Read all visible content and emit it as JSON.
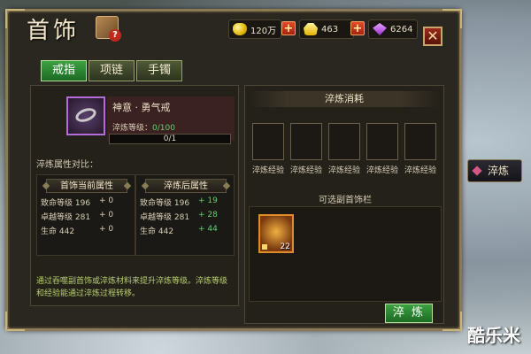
{
  "header": {
    "title": "首饰"
  },
  "currency": {
    "gold": "120万",
    "ingot": "463",
    "gem": "6264"
  },
  "tabs": [
    {
      "label": "戒指",
      "active": true
    },
    {
      "label": "项链",
      "active": false
    },
    {
      "label": "手镯",
      "active": false
    }
  ],
  "item": {
    "name": "神意 · 勇气戒",
    "refine_label": "淬炼等级：",
    "refine_value": "0/100",
    "progress_text": "0/1"
  },
  "compare": {
    "title": "淬炼属性对比：",
    "current": {
      "head": "首饰当前属性",
      "rows": [
        {
          "name": "致命等级 196",
          "inc": "+ 0"
        },
        {
          "name": "卓越等级 281",
          "inc": "+ 0"
        },
        {
          "name": "生命 442",
          "inc": "+ 0"
        }
      ]
    },
    "after": {
      "head": "淬炼后属性",
      "rows": [
        {
          "name": "致命等级 196",
          "inc": "+ 19"
        },
        {
          "name": "卓越等级 281",
          "inc": "+ 28"
        },
        {
          "name": "生命 442",
          "inc": "+ 44"
        }
      ]
    }
  },
  "hint": "通过吞噬副首饰或淬炼材料来提升淬炼等级。淬炼等级和经验能通过淬炼过程转移。",
  "consume": {
    "head": "淬炼消耗",
    "slots": [
      "淬炼经验",
      "淬炼经验",
      "淬炼经验",
      "淬炼经验",
      "淬炼经验"
    ]
  },
  "bag": {
    "head": "可选副首饰栏",
    "items": [
      {
        "count": "22"
      }
    ]
  },
  "refine_button": "淬 炼",
  "side_tab": "淬炼",
  "watermark": "酷乐米",
  "colors": {
    "accent_green": "#3da142",
    "gold_border": "#8a7a55",
    "value_green": "#5ed466"
  }
}
